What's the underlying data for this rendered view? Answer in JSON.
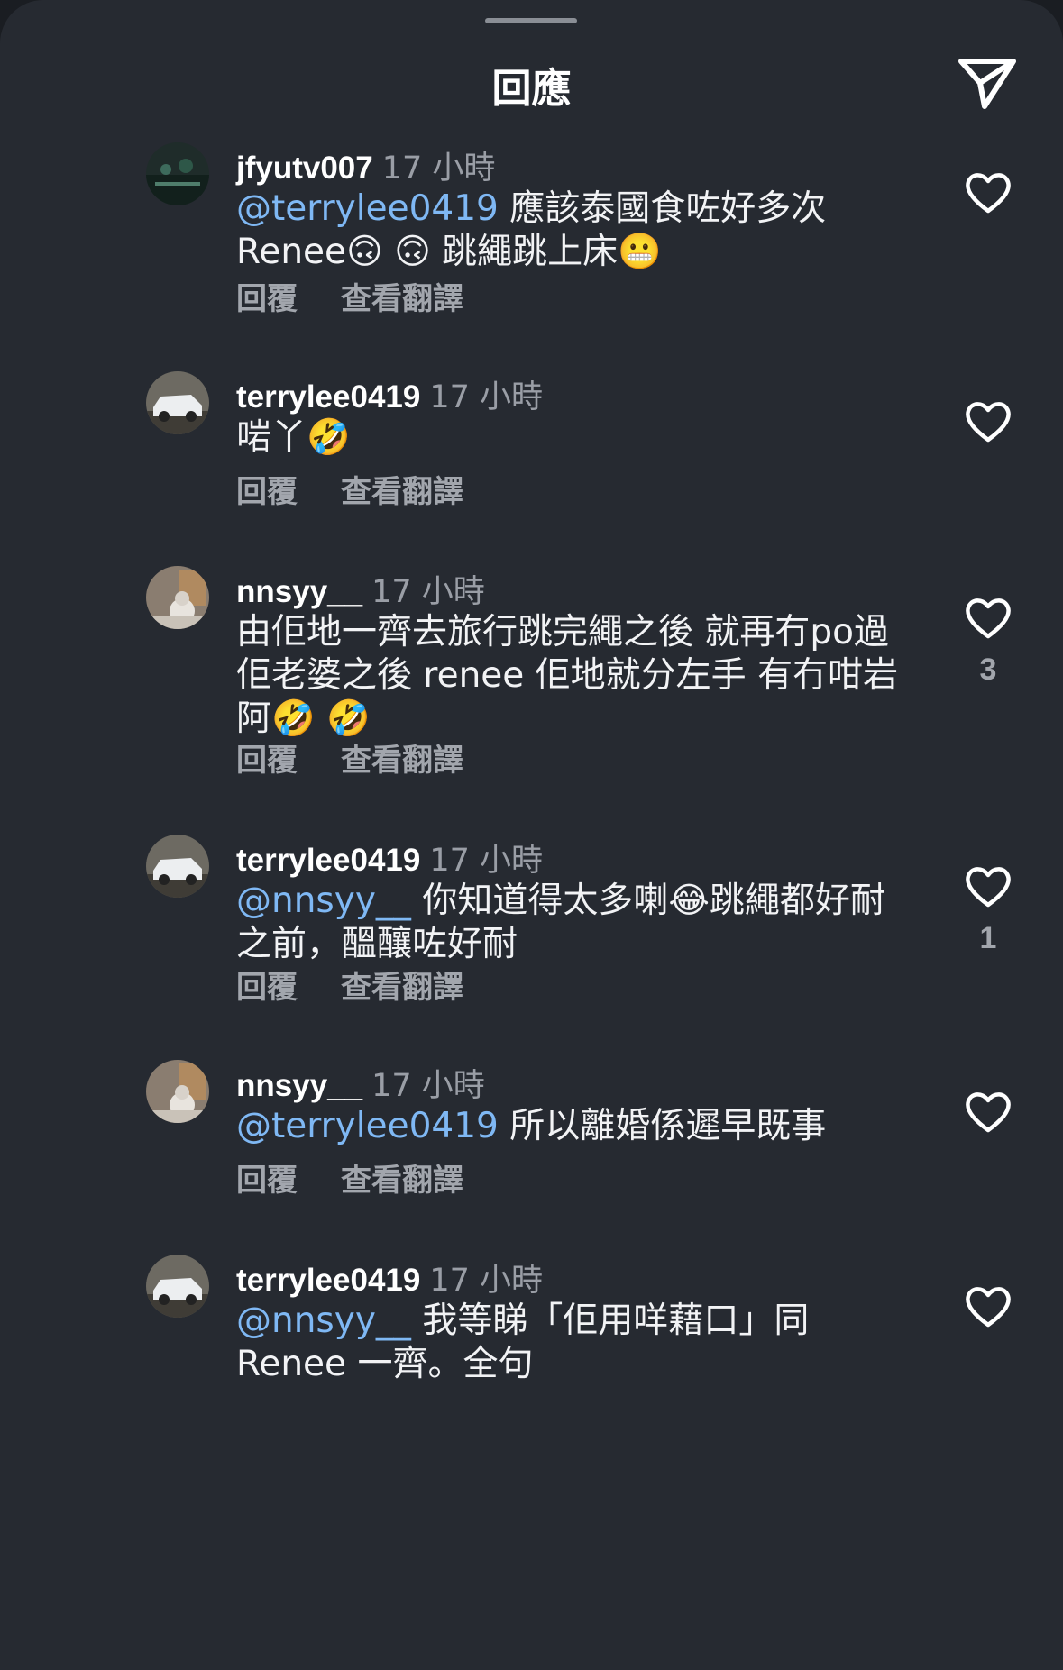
{
  "header": {
    "title": "回應"
  },
  "comments": [
    {
      "username": "jfyutv007",
      "time": "17 小時",
      "mention": "@terrylee0419",
      "text": " 應該泰國食咗好多次 Renee🙃 🙃 跳繩跳上床😬",
      "reply_label": "回覆",
      "translate_label": "查看翻譯",
      "likes": ""
    },
    {
      "username": "terrylee0419",
      "time": "17 小時",
      "mention": "",
      "text": "啱丫🤣",
      "reply_label": "回覆",
      "translate_label": "查看翻譯",
      "likes": ""
    },
    {
      "username": "nnsyy__",
      "time": "17 小時",
      "mention": "",
      "text": "由佢地一齊去旅行跳完繩之後 就再冇po過佢老婆之後 renee 佢地就分左手 有冇咁岩阿🤣 🤣",
      "reply_label": "回覆",
      "translate_label": "查看翻譯",
      "likes": "3"
    },
    {
      "username": "terrylee0419",
      "time": "17 小時",
      "mention": "@nnsyy__",
      "text": " 你知道得太多喇😂跳繩都好耐之前，醞釀咗好耐",
      "reply_label": "回覆",
      "translate_label": "查看翻譯",
      "likes": "1"
    },
    {
      "username": "nnsyy__",
      "time": "17 小時",
      "mention": "@terrylee0419",
      "text": " 所以離婚係遲早既事",
      "reply_label": "回覆",
      "translate_label": "查看翻譯",
      "likes": ""
    },
    {
      "username": "terrylee0419",
      "time": "17 小時",
      "mention": "@nnsyy__",
      "text": " 我等睇「佢用咩藉口」同 Renee 一齊。全句",
      "reply_label": "",
      "translate_label": "",
      "likes": ""
    }
  ],
  "icons": {
    "send": "send-paper-plane-icon",
    "like": "heart-outline-icon"
  },
  "colors": {
    "background": "#262a31",
    "mention": "#7fb8f4",
    "secondary_text": "#a2a6ad"
  }
}
